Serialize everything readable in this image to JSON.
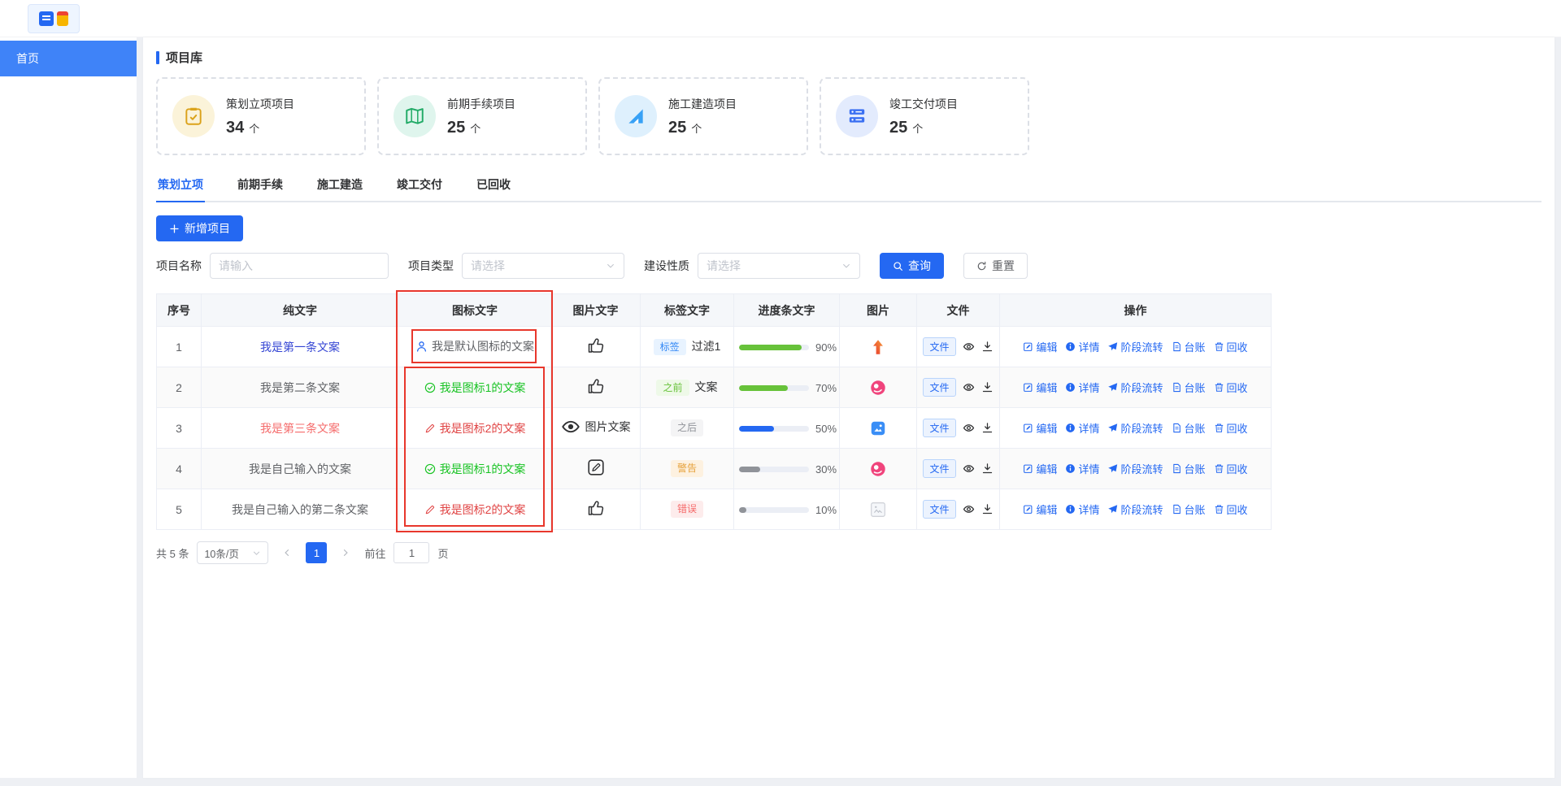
{
  "sidebar": {
    "items": [
      {
        "label": "首页",
        "active": true
      }
    ]
  },
  "page": {
    "title": "项目库"
  },
  "stats": [
    {
      "label": "策划立项项目",
      "value": "34",
      "unit": "个",
      "icon": "clipboard-check-icon",
      "accent": "#dba21a"
    },
    {
      "label": "前期手续项目",
      "value": "25",
      "unit": "个",
      "icon": "blueprint-map-icon",
      "accent": "#22ab67"
    },
    {
      "label": "施工建造项目",
      "value": "25",
      "unit": "个",
      "icon": "triangle-ruler-icon",
      "accent": "#37a1f6"
    },
    {
      "label": "竣工交付项目",
      "value": "25",
      "unit": "个",
      "icon": "server-stack-icon",
      "accent": "#3b70f2"
    }
  ],
  "tabs": [
    {
      "label": "策划立项",
      "active": true
    },
    {
      "label": "前期手续",
      "active": false
    },
    {
      "label": "施工建造",
      "active": false
    },
    {
      "label": "竣工交付",
      "active": false
    },
    {
      "label": "已回收",
      "active": false
    }
  ],
  "toolbar": {
    "add_button": "新增项目"
  },
  "filters": {
    "name_label": "项目名称",
    "name_placeholder": "请输入",
    "type_label": "项目类型",
    "type_placeholder": "请选择",
    "nature_label": "建设性质",
    "nature_placeholder": "请选择",
    "search_button": "查询",
    "reset_button": "重置"
  },
  "table": {
    "columns": [
      "序号",
      "纯文字",
      "图标文字",
      "图片文字",
      "标签文字",
      "进度条文字",
      "图片",
      "文件",
      "操作"
    ],
    "file_button_label": "文件",
    "operations": [
      {
        "name": "edit",
        "label": "编辑",
        "icon": "edit-square-icon"
      },
      {
        "name": "detail",
        "label": "详情",
        "icon": "info-circle-icon"
      },
      {
        "name": "stage-transfer",
        "label": "阶段流转",
        "icon": "send-icon"
      },
      {
        "name": "ledger",
        "label": "台账",
        "icon": "document-icon"
      },
      {
        "name": "recycle",
        "label": "回收",
        "icon": "trash-icon"
      }
    ],
    "rows": [
      {
        "index": "1",
        "plain_text": "我是第一条文案",
        "plain_color": "#3546d4",
        "icon_text": {
          "icon": "user-icon",
          "icon_color": "#2468f2",
          "label": "我是默认图标的文案",
          "color": "#606266"
        },
        "image_text": {
          "icon": "thumbs-up-icon",
          "label": ""
        },
        "tag": {
          "label": "标签",
          "type": "primary",
          "suffix": "过滤1"
        },
        "progress": {
          "percent": 90,
          "label": "90%",
          "color": "#67c23a"
        },
        "image": "arrow-up-image"
      },
      {
        "index": "2",
        "plain_text": "我是第二条文案",
        "plain_color": "#606266",
        "icon_text": {
          "icon": "check-circle-icon",
          "icon_color": "#17c322",
          "label": "我是图标1的文案",
          "color": "#17c322"
        },
        "image_text": {
          "icon": "thumbs-up-icon",
          "label": ""
        },
        "tag": {
          "label": "之前",
          "type": "success",
          "suffix": "文案"
        },
        "progress": {
          "percent": 70,
          "label": "70%",
          "color": "#67c23a"
        },
        "image": "pink-circle-image"
      },
      {
        "index": "3",
        "plain_text": "我是第三条文案",
        "plain_color": "#f56c6c",
        "icon_text": {
          "icon": "pen-icon",
          "icon_color": "#e04343",
          "label": "我是图标2的文案",
          "color": "#e04343"
        },
        "image_text": {
          "icon": "eye-bold-icon",
          "label": "图片文案"
        },
        "tag": {
          "label": "之后",
          "type": "info",
          "suffix": ""
        },
        "progress": {
          "percent": 50,
          "label": "50%",
          "color": "#2468f2"
        },
        "image": "blue-square-image"
      },
      {
        "index": "4",
        "plain_text": "我是自己输入的文案",
        "plain_color": "#606266",
        "icon_text": {
          "icon": "check-circle-icon",
          "icon_color": "#17c322",
          "label": "我是图标1的文案",
          "color": "#17c322"
        },
        "image_text": {
          "icon": "edit-box-icon",
          "label": ""
        },
        "tag": {
          "label": "警告",
          "type": "warning",
          "suffix": ""
        },
        "progress": {
          "percent": 30,
          "label": "30%",
          "color": "#909399"
        },
        "image": "pink-circle-image"
      },
      {
        "index": "5",
        "plain_text": "我是自己输入的第二条文案",
        "plain_color": "#606266",
        "icon_text": {
          "icon": "pen-icon",
          "icon_color": "#e04343",
          "label": "我是图标2的文案",
          "color": "#e04343"
        },
        "image_text": {
          "icon": "thumbs-up-icon",
          "label": ""
        },
        "tag": {
          "label": "错误",
          "type": "danger",
          "suffix": ""
        },
        "progress": {
          "percent": 10,
          "label": "10%",
          "color": "#909399"
        },
        "image": "image-placeholder-icon"
      }
    ]
  },
  "pagination": {
    "total": "共 5 条",
    "page_size": "10条/页",
    "pages": [
      "1"
    ],
    "goto_label": "前往",
    "goto_value": "1",
    "goto_suffix": "页"
  },
  "colors": {
    "primary": "#2468f2",
    "annotation": "#e8372c"
  }
}
